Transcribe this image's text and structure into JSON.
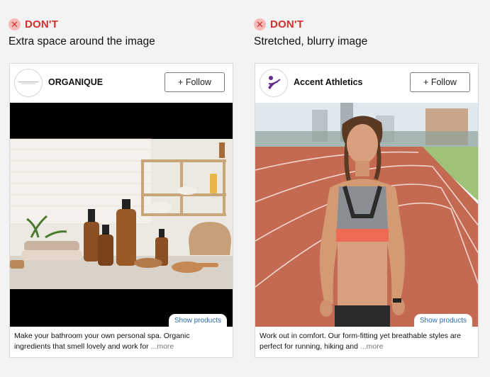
{
  "panels": [
    {
      "dont_icon": "close-x-icon",
      "dont_label": "DON'T",
      "description": "Extra space around the image",
      "card": {
        "brand_name": "ORGANIQUE",
        "avatar_icon": "organique-logo-icon",
        "follow_label": "+ Follow",
        "show_products_label": "Show products",
        "caption_text": "Make your bathroom your own personal spa. Organic ingredients that smell lovely and work for",
        "more_label": "...more"
      }
    },
    {
      "dont_icon": "close-x-icon",
      "dont_label": "DON'T",
      "description": "Stretched, blurry image",
      "card": {
        "brand_name": "Accent Athletics",
        "avatar_icon": "accent-athletics-logo-icon",
        "follow_label": "+ Follow",
        "show_products_label": "Show products",
        "caption_text": "Work out in comfort. Our form-fitting yet breathable styles are perfect for running, hiking and",
        "more_label": "...more"
      }
    }
  ],
  "colors": {
    "dont_red": "#d0312d",
    "link_blue": "#2b6cb0"
  }
}
